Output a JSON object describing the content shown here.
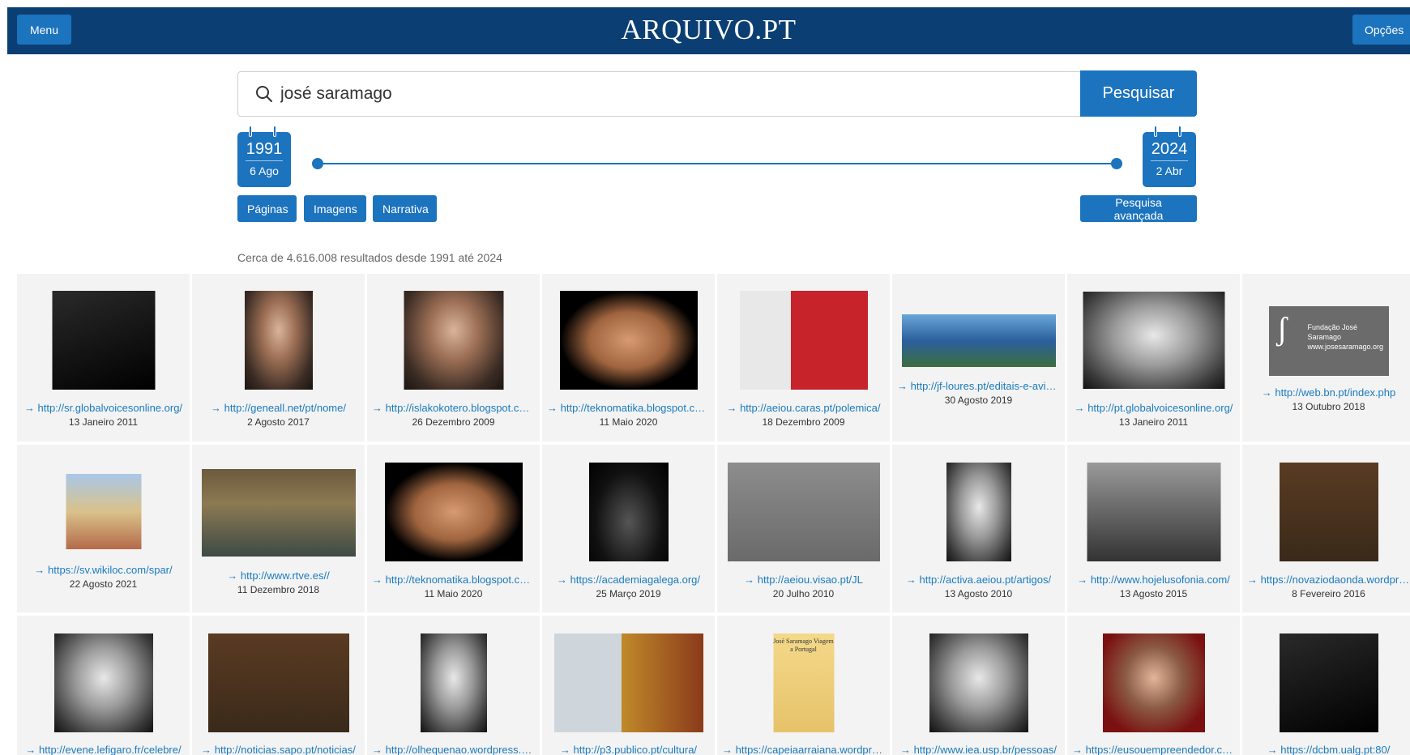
{
  "header": {
    "menu_label": "Menu",
    "logo": "ARQUIVO.PT",
    "options_label": "Opções"
  },
  "search": {
    "query": "josé saramago",
    "submit_label": "Pesquisar"
  },
  "date_range": {
    "start": {
      "year": "1991",
      "day": "6 Ago"
    },
    "end": {
      "year": "2024",
      "day": "2 Abr"
    }
  },
  "types": {
    "pages": "Páginas",
    "images": "Imagens",
    "narrative": "Narrativa",
    "advanced": "Pesquisa avançada"
  },
  "results_count": "Cerca de 4.616.008 resultados desde 1991 até 2024",
  "results": [
    {
      "url": "→ http://sr.globalvoicesonline.org/",
      "date": "13 Janeiro 2011"
    },
    {
      "url": "→ http://geneall.net/pt/nome/",
      "date": "2 Agosto 2017"
    },
    {
      "url": "→ http://islakokotero.blogspot.com/",
      "date": "26 Dezembro 2009"
    },
    {
      "url": "→ http://teknomatika.blogspot.com/",
      "date": "11 Maio 2020"
    },
    {
      "url": "→ http://aeiou.caras.pt/polemica/",
      "date": "18 Dezembro 2009"
    },
    {
      "url": "→ http://jf-loures.pt/editais-e-avisos/",
      "date": "30 Agosto 2019"
    },
    {
      "url": "→ http://pt.globalvoicesonline.org/",
      "date": "13 Janeiro 2011"
    },
    {
      "url": "→ http://web.bn.pt/index.php",
      "date": "13 Outubro 2018",
      "caption": "Fundação José Saramago www.josesaramago.org"
    },
    {
      "url": "→ https://sv.wikiloc.com/spar/",
      "date": "22 Agosto 2021"
    },
    {
      "url": "→ http://www.rtve.es//",
      "date": "11 Dezembro 2018"
    },
    {
      "url": "→ http://teknomatika.blogspot.com/",
      "date": "11 Maio 2020"
    },
    {
      "url": "→ https://academiagalega.org/",
      "date": "25 Março 2019"
    },
    {
      "url": "→ http://aeiou.visao.pt/JL",
      "date": "20 Julho 2010"
    },
    {
      "url": "→ http://activa.aeiou.pt/artigos/",
      "date": "13 Agosto 2010"
    },
    {
      "url": "→ http://www.hojelusofonia.com/",
      "date": "13 Agosto 2015"
    },
    {
      "url": "→ https://novaziodaonda.wordpress.com/",
      "date": "8 Fevereiro 2016"
    },
    {
      "url": "→ http://evene.lefigaro.fr/celebre/",
      "date": ""
    },
    {
      "url": "→ http://noticias.sapo.pt/noticias/",
      "date": ""
    },
    {
      "url": "→ http://olhequenao.wordpress.com/",
      "date": ""
    },
    {
      "url": "→ http://p3.publico.pt/cultura/",
      "date": ""
    },
    {
      "url": "→ https://capeiaarraiana.wordpress.com/",
      "date": "",
      "caption": "José Saramago Viagem a Portugal"
    },
    {
      "url": "→ http://www.iea.usp.br/pessoas/",
      "date": ""
    },
    {
      "url": "→ https://eusouempreendedor.com/",
      "date": ""
    },
    {
      "url": "→ https://dcbm.ualg.pt:80/",
      "date": ""
    }
  ]
}
